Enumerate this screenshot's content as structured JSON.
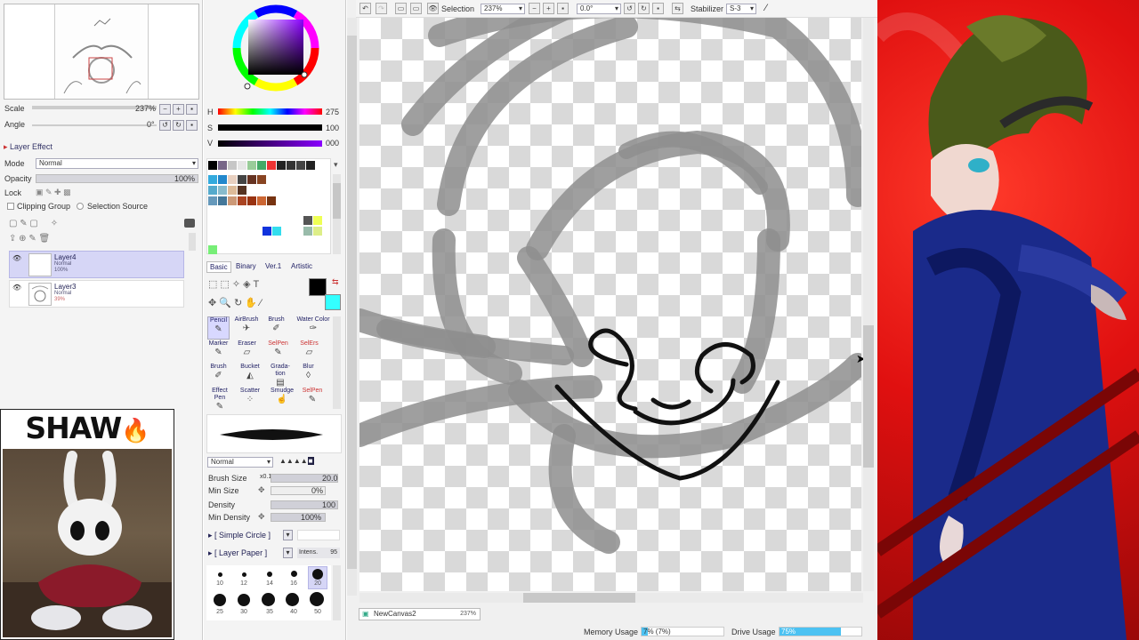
{
  "navigator": {
    "scale_label": "Scale",
    "scale_value": "237%",
    "angle_label": "Angle",
    "angle_value": "0°"
  },
  "layer_effect": {
    "label": "Layer Effect"
  },
  "layer_props": {
    "mode_label": "Mode",
    "mode_value": "Normal",
    "opacity_label": "Opacity",
    "opacity_value": "100%",
    "lock_label": "Lock",
    "clipping_label": "Clipping Group",
    "selection_source_label": "Selection Source"
  },
  "layers": [
    {
      "name": "Layer4",
      "mode": "Normal",
      "opacity": "100%"
    },
    {
      "name": "Layer3",
      "mode": "Normal",
      "opacity": "39%"
    }
  ],
  "color": {
    "h_label": "H",
    "h_value": "275",
    "s_label": "S",
    "s_value": "100",
    "v_label": "V",
    "v_value": "000",
    "main": "#000000",
    "sub": "#33ffff"
  },
  "tool_tabs": [
    "Basic",
    "Binary",
    "Ver.1",
    "Artistic"
  ],
  "tools": [
    "Pencil",
    "AirBrush",
    "Brush",
    "Water Color",
    "Marker",
    "Eraser",
    "SelPen",
    "SelErs",
    "Brush",
    "Bucket",
    "Grada-tion",
    "Blur",
    "Effect Pen",
    "Scatter",
    "Smudge",
    "SelPen"
  ],
  "brush": {
    "mode_value": "Normal",
    "size_label": "Brush Size",
    "size_mult": "x0.1",
    "size_value": "20.0",
    "min_size_label": "Min Size",
    "min_size_value": "0%",
    "density_label": "Density",
    "density_value": "100",
    "min_density_label": "Min Density",
    "min_density_value": "100%",
    "shape_label": "[ Simple Circle ]",
    "texture_label": "[ Layer Paper ]",
    "intens_label": "Intens.",
    "intens_value": "95",
    "size_dots": [
      "10",
      "12",
      "14",
      "16",
      "20",
      "25",
      "30",
      "35",
      "40",
      "50"
    ]
  },
  "toolbar": {
    "selection_label": "Selection",
    "zoom_value": "237%",
    "angle_value": "0.0°",
    "stabilizer_label": "Stabilizer",
    "stabilizer_value": "S-3"
  },
  "canvas_tab": {
    "name": "NewCanvas2",
    "zoom": "237%"
  },
  "status": {
    "memory_label": "Memory Usage",
    "memory_value": "7% (7%)",
    "drive_label": "Drive Usage",
    "drive_value": "75%",
    "drive_fraction": 0.75
  },
  "webcam": {
    "caption": "SHAW",
    "emoji": "🔥"
  }
}
